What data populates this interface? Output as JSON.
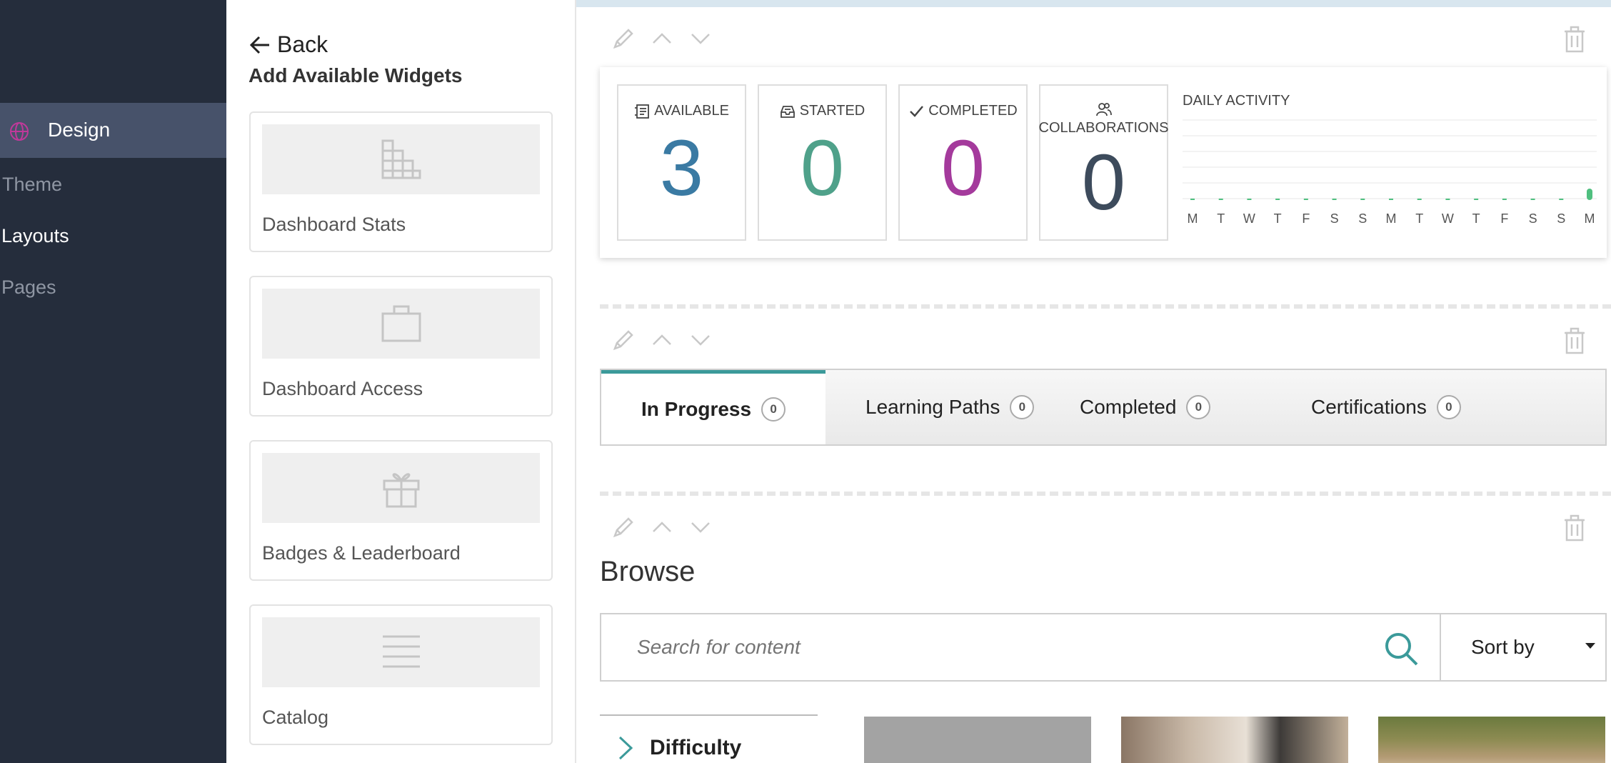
{
  "nav": {
    "active_label": "Design",
    "items": [
      "Theme",
      "Layouts",
      "Pages"
    ],
    "accent": "#c0399a"
  },
  "panel": {
    "back_label": "Back",
    "title": "Add Available Widgets",
    "widgets": [
      {
        "label": "Dashboard Stats",
        "icon": "stats-blocks-icon"
      },
      {
        "label": "Dashboard Access",
        "icon": "briefcase-icon"
      },
      {
        "label": "Badges & Leaderboard",
        "icon": "gift-icon"
      },
      {
        "label": "Catalog",
        "icon": "lines-icon"
      }
    ]
  },
  "stats": {
    "available": {
      "label": "AVAILABLE",
      "value": "3",
      "color": "#3a7aa3"
    },
    "started": {
      "label": "STARTED",
      "value": "0",
      "color": "#4fa18a"
    },
    "completed": {
      "label": "COMPLETED",
      "value": "0",
      "color": "#a43a9c"
    },
    "collaborations": {
      "label": "COLLABORATIONS",
      "value": "0",
      "color": "#3d4b5c"
    },
    "activity": {
      "title": "DAILY ACTIVITY",
      "days": [
        "M",
        "T",
        "W",
        "T",
        "F",
        "S",
        "S",
        "M",
        "T",
        "W",
        "T",
        "F",
        "S",
        "S",
        "M"
      ],
      "values": [
        0,
        0,
        0,
        0,
        0,
        0,
        0,
        0,
        0,
        0,
        0,
        0,
        0,
        0,
        1
      ],
      "bar_color": "#4fbf7f"
    }
  },
  "tabs": [
    {
      "label": "In Progress",
      "count": "0"
    },
    {
      "label": "Learning Paths",
      "count": "0"
    },
    {
      "label": "Completed",
      "count": "0"
    },
    {
      "label": "Certifications",
      "count": "0"
    }
  ],
  "browse": {
    "title": "Browse",
    "search_placeholder": "Search for content",
    "sort_label": "Sort by",
    "filter_label": "Difficulty"
  }
}
